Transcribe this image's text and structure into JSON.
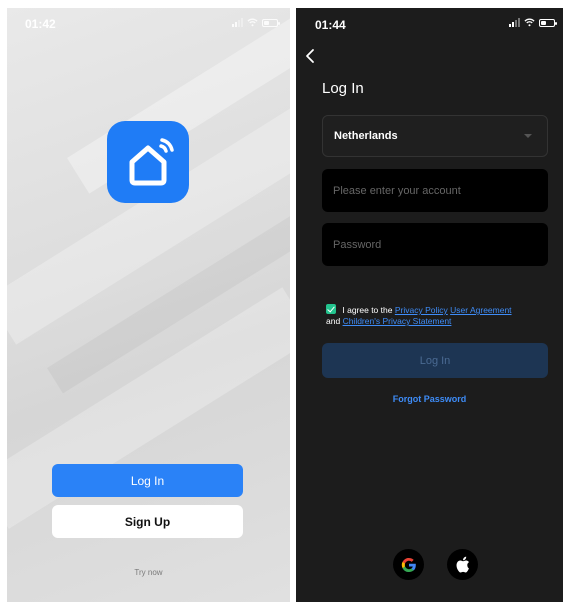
{
  "welcome": {
    "status_time": "01:42",
    "login_label": "Log In",
    "signup_label": "Sign Up",
    "try_now": "Try now",
    "app_icon": "smart-home-house-icon"
  },
  "login": {
    "status_time": "01:44",
    "title": "Log In",
    "country": "Netherlands",
    "account_placeholder": "Please enter your account",
    "password_placeholder": "Password",
    "agree_text": "I agree to the",
    "privacy_policy": "Privacy Policy",
    "user_agreement": "User Agreement",
    "and_text": "and",
    "children_privacy": "Children's Privacy Statement",
    "agree_checked": true,
    "login_button": "Log In",
    "forgot_password": "Forgot Password",
    "social": [
      "google-icon",
      "apple-icon"
    ]
  },
  "colors": {
    "accent": "#2a82f7",
    "link": "#3e8cf7",
    "checkbox": "#23c48e",
    "dark_bg": "#1c1c1c"
  }
}
